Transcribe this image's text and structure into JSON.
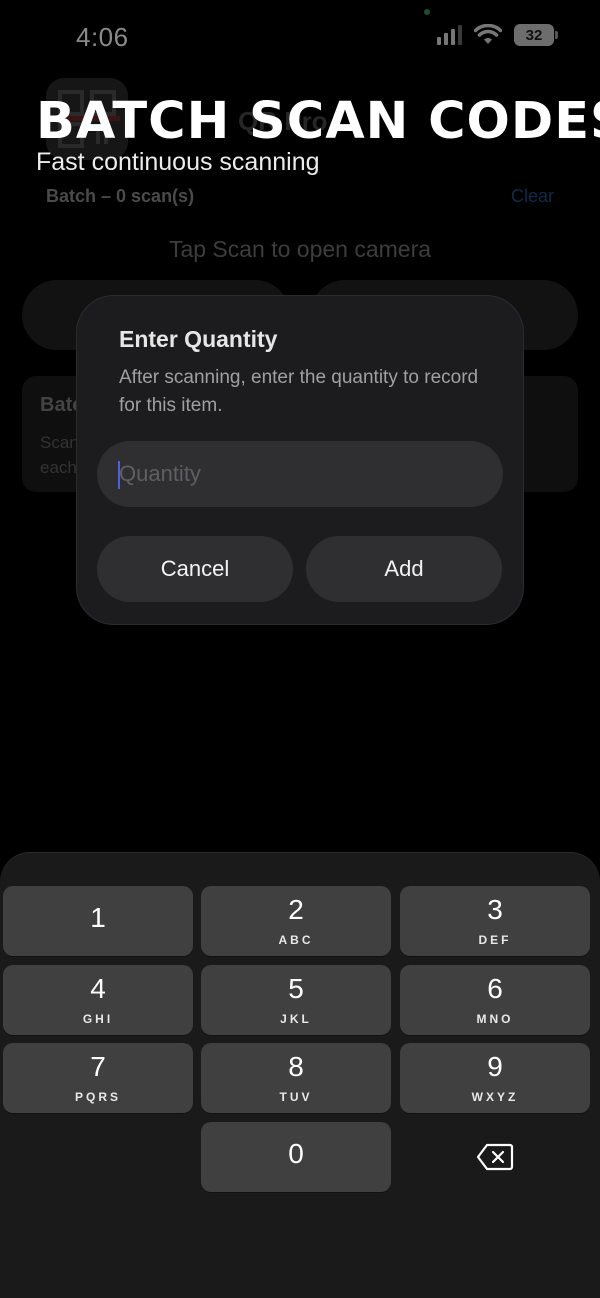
{
  "status_bar": {
    "time": "4:06",
    "battery": "32"
  },
  "background_app": {
    "name": "QR Pro",
    "batch_label": "Batch  –  0 scan(s)",
    "clear": "Clear",
    "hint": "Tap Scan to open camera",
    "card_title": "Batch",
    "card_text_line1": "Scan",
    "card_text_line2": "each"
  },
  "overlay": {
    "headline": "BATCH SCAN CODES",
    "subheadline": "Fast continuous scanning"
  },
  "dialog": {
    "title": "Enter Quantity",
    "message": "After scanning, enter the quantity to record for this item.",
    "input_placeholder": "Quantity",
    "cancel": "Cancel",
    "add": "Add"
  },
  "keyboard": {
    "keys": [
      {
        "num": "1",
        "letters": ""
      },
      {
        "num": "2",
        "letters": "ABC"
      },
      {
        "num": "3",
        "letters": "DEF"
      },
      {
        "num": "4",
        "letters": "GHI"
      },
      {
        "num": "5",
        "letters": "JKL"
      },
      {
        "num": "6",
        "letters": "MNO"
      },
      {
        "num": "7",
        "letters": "PQRS"
      },
      {
        "num": "8",
        "letters": "TUV"
      },
      {
        "num": "9",
        "letters": "WXYZ"
      },
      {
        "num": "0",
        "letters": ""
      }
    ]
  }
}
